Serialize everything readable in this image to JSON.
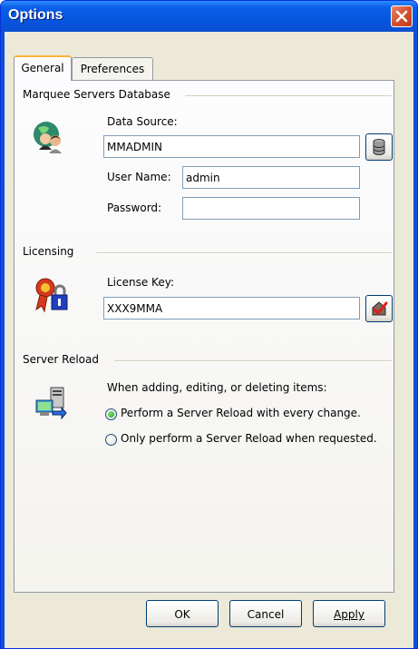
{
  "window": {
    "title": "Options"
  },
  "tabs": [
    {
      "label": "General",
      "active": true
    },
    {
      "label": "Preferences",
      "active": false
    }
  ],
  "database": {
    "group_title": "Marquee Servers Database",
    "data_source_label": "Data Source:",
    "data_source_value": "MMADMIN",
    "user_name_label": "User Name:",
    "user_name_value": "admin",
    "password_label": "Password:",
    "password_value": ""
  },
  "licensing": {
    "group_title": "Licensing",
    "license_key_label": "License Key:",
    "license_key_value": "XXX9MMA"
  },
  "server_reload": {
    "group_title": "Server Reload",
    "description": "When adding, editing, or deleting items:",
    "options": [
      {
        "label": "Perform a Server Reload with every change.",
        "selected": true
      },
      {
        "label": "Only perform a Server Reload when requested.",
        "selected": false
      }
    ]
  },
  "buttons": {
    "ok": "OK",
    "cancel": "Cancel",
    "apply": "Apply"
  },
  "icons": {
    "close": "close-icon",
    "users": "users-globe-icon",
    "database": "database-icon",
    "license": "license-lock-icon",
    "validate": "validate-check-icon",
    "reload": "server-reload-icon"
  }
}
